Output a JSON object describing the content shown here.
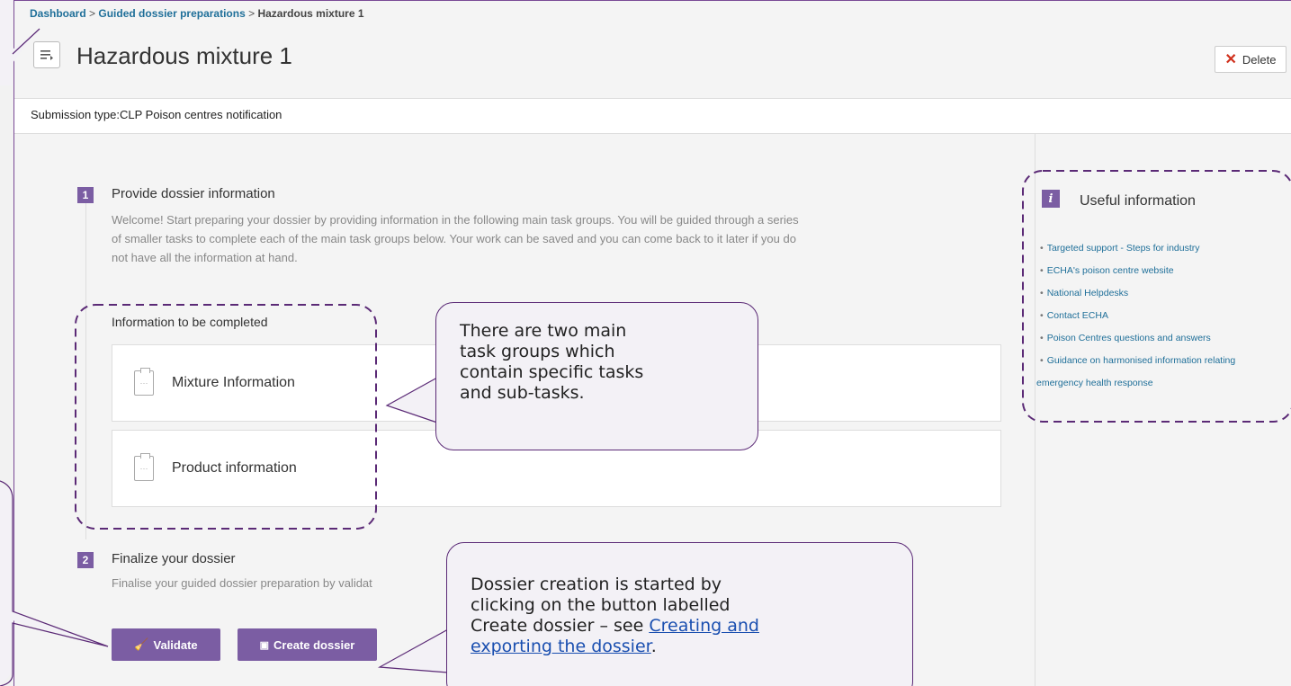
{
  "breadcrumb": {
    "items": [
      "Dashboard",
      "Guided dossier preparations"
    ],
    "separator": ">",
    "current": "Hazardous mixture 1"
  },
  "header": {
    "title": "Hazardous mixture 1",
    "delete_label": "Delete",
    "menu_icon": "list-toggle-icon"
  },
  "submission": {
    "text": "Submission type:CLP Poison centres notification"
  },
  "steps": [
    {
      "number": "1",
      "title": "Provide dossier information",
      "description_lines": [
        "Welcome! Start preparing your dossier by providing information in the following main task groups. You will be guided through a series",
        "of smaller tasks to complete each of the main task groups below. Your work can be saved and you can come back to it later if you do",
        "not have all the information at hand."
      ]
    },
    {
      "number": "2",
      "title": "Finalize your dossier",
      "description": "Finalise your guided dossier preparation by validat"
    }
  ],
  "info_section": {
    "label": "Information to be completed",
    "tasks": [
      "Mixture Information",
      "Product information"
    ]
  },
  "buttons": {
    "validate": "Validate",
    "create_dossier": "Create dossier"
  },
  "useful_info": {
    "title": "Useful information",
    "links": [
      "Targeted support - Steps for industry",
      "ECHA's poison centre website",
      "National Helpdesks",
      "Contact ECHA",
      "Poison Centres questions and answers",
      "Guidance on harmonised information relating"
    ],
    "link_continuation": "emergency health response"
  },
  "callouts": {
    "task_groups_lines": [
      "There are two main",
      "task groups which",
      "contain specific tasks",
      "and sub-tasks."
    ],
    "dossier_lines": [
      "Dossier creation is started by",
      "clicking on the button labelled"
    ],
    "dossier_line3_prefix": "Create dossier – see ",
    "dossier_link_part1": "Creating and",
    "dossier_link_part2": "exporting the dossier",
    "dossier_suffix": "."
  },
  "colors": {
    "accent": "#7b5da3",
    "callout_border": "#5b2a76",
    "link": "#1f6f99",
    "delete": "#d0301c"
  }
}
